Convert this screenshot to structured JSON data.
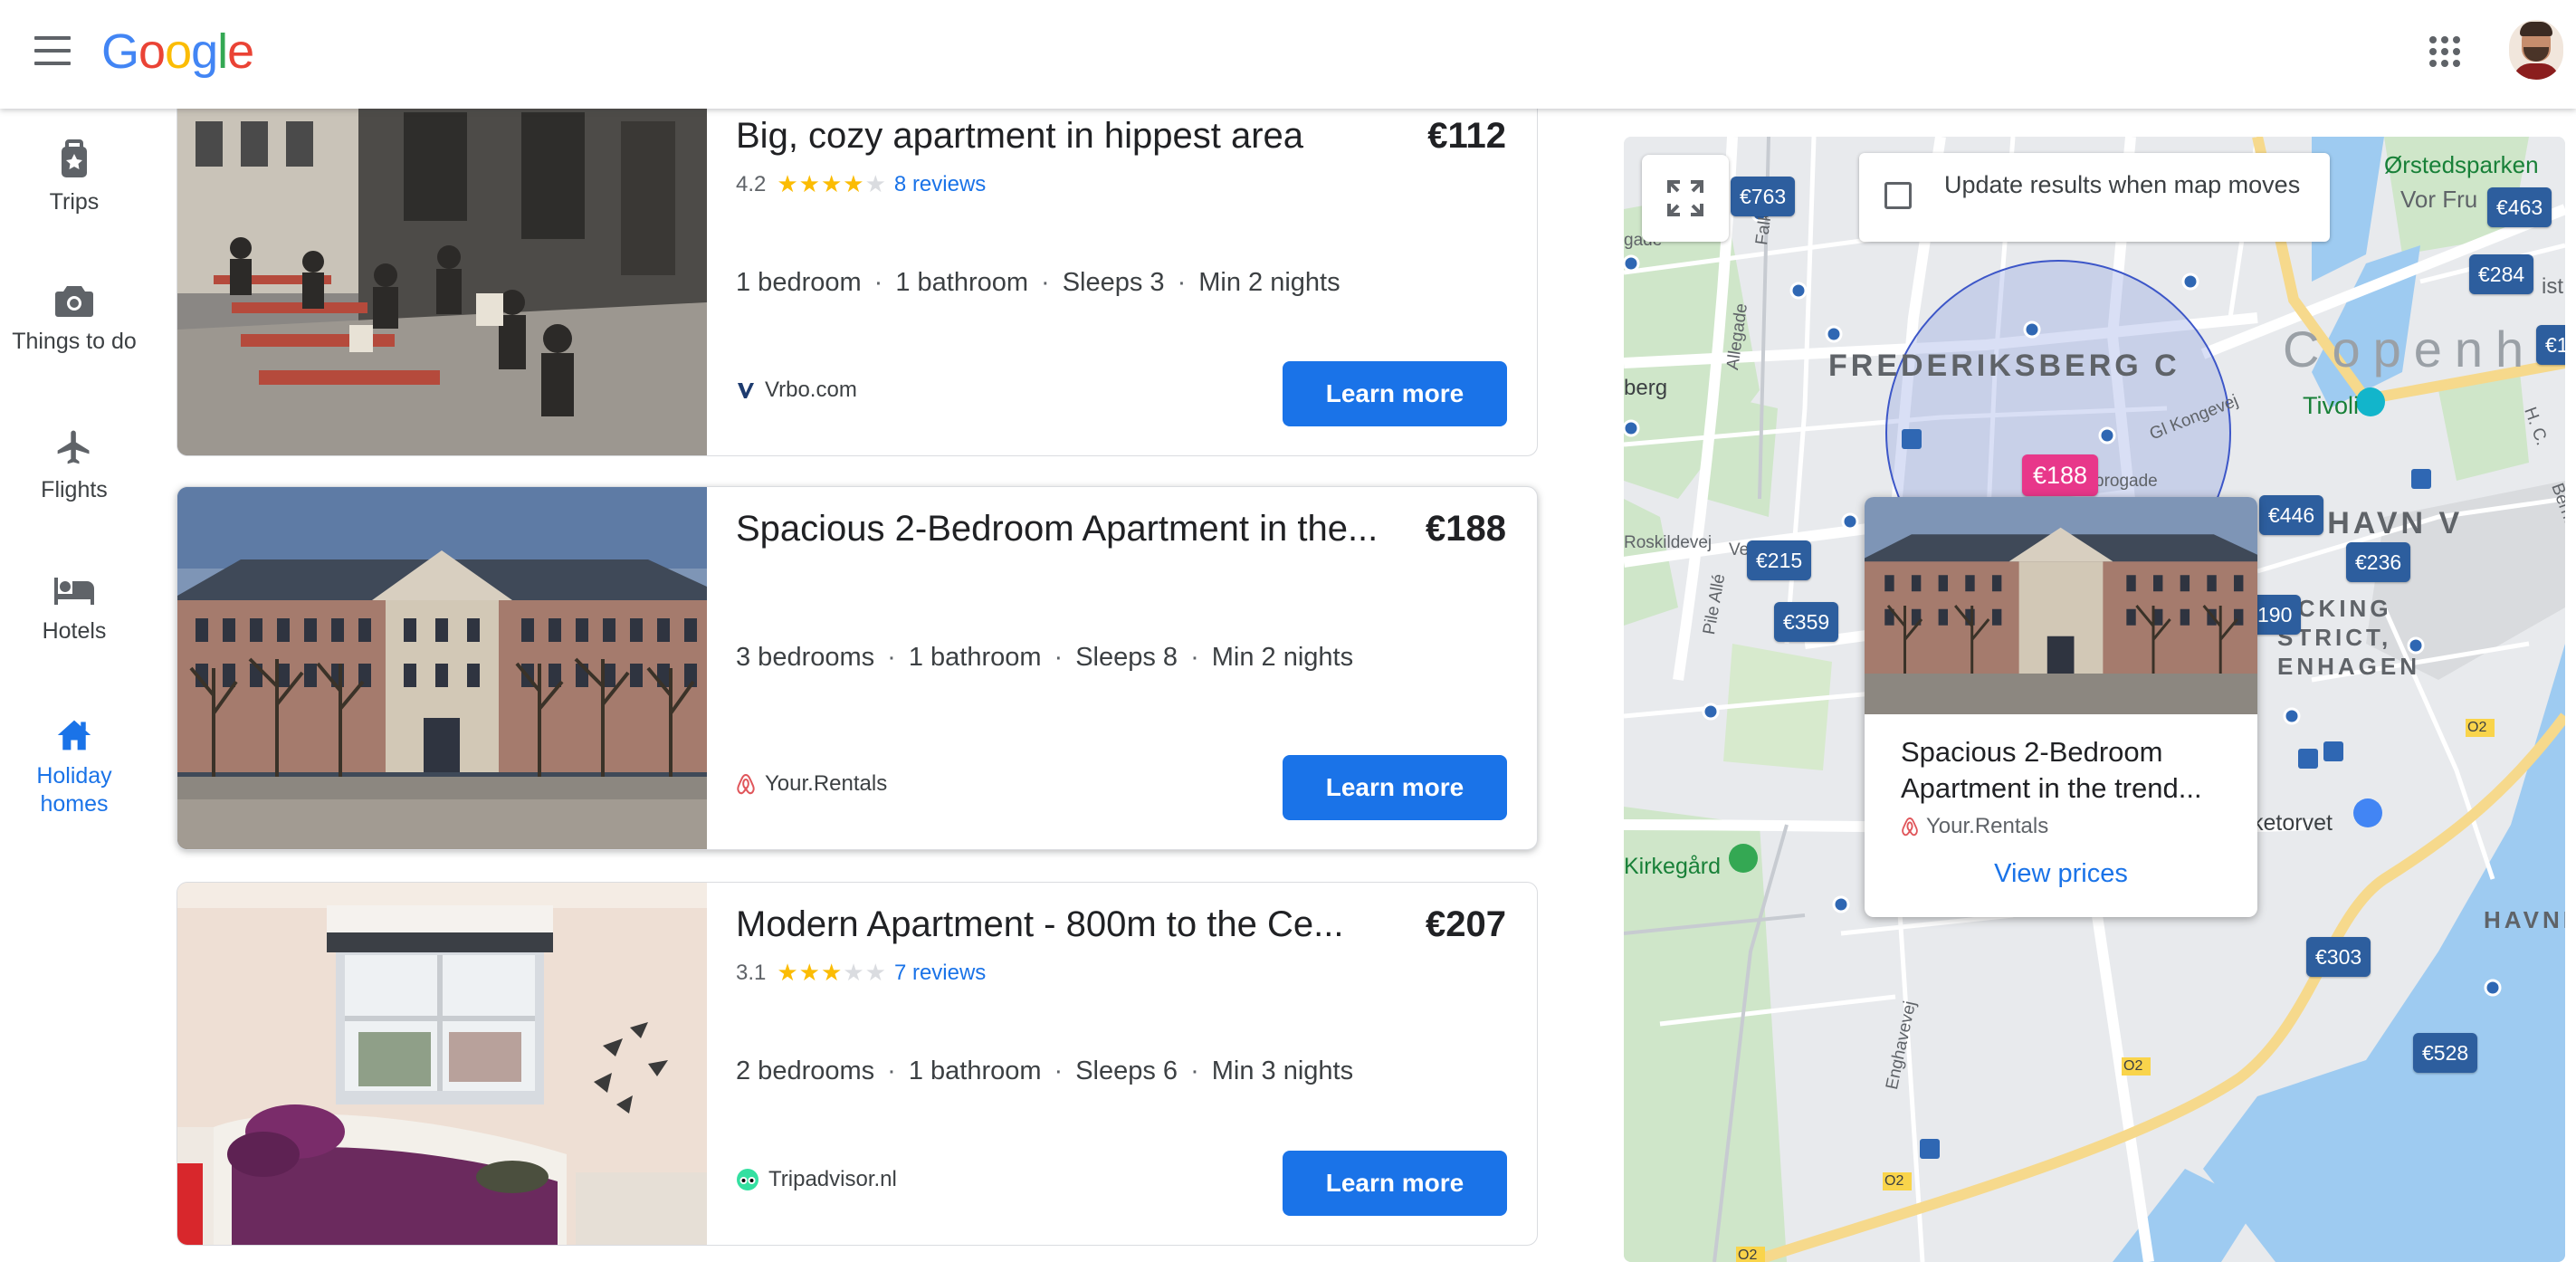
{
  "header": {
    "logo": [
      "G",
      "o",
      "o",
      "g",
      "l",
      "e"
    ],
    "menu_icon": "menu-icon",
    "apps_icon": "apps-grid-icon"
  },
  "nav": [
    {
      "label": "Trips",
      "icon": "trips-icon"
    },
    {
      "label": "Things to do",
      "icon": "camera-icon"
    },
    {
      "label": "Flights",
      "icon": "airplane-icon"
    },
    {
      "label": "Hotels",
      "icon": "bed-icon"
    },
    {
      "label": "Holiday homes",
      "icon": "home-icon",
      "active": true
    }
  ],
  "listings": [
    {
      "title": "Big, cozy apartment in hippest area",
      "price": "€112",
      "rating": "4.2",
      "stars": 4,
      "reviews": "8 reviews",
      "bedrooms": "1 bedroom",
      "bathrooms": "1 bathroom",
      "sleeps": "Sleeps 3",
      "min_nights": "Min 2 nights",
      "provider": "Vrbo.com",
      "cta": "Learn more"
    },
    {
      "title": "Spacious 2-Bedroom Apartment in the...",
      "price": "€188",
      "bedrooms": "3 bedrooms",
      "bathrooms": "1 bathroom",
      "sleeps": "Sleeps 8",
      "min_nights": "Min 2 nights",
      "provider": "Your.Rentals",
      "cta": "Learn more"
    },
    {
      "title": "Modern Apartment - 800m to the Ce...",
      "price": "€207",
      "rating": "3.1",
      "stars": 3,
      "reviews": "7 reviews",
      "bedrooms": "2 bedrooms",
      "bathrooms": "1 bathroom",
      "sleeps": "Sleeps 6",
      "min_nights": "Min 3 nights",
      "provider": "Tripadvisor.nl",
      "cta": "Learn more"
    }
  ],
  "map": {
    "update_label": "Update results when map moves",
    "areas": {
      "frederiksberg": "FREDERIKSBERG C",
      "copenhagen": "Copenh",
      "kobenhavn_v": "ENHAVN V",
      "packing": "ACKING",
      "district": "STRICT,",
      "enhagen": "ENHAGEN",
      "havnes": "HAVNES"
    },
    "places": {
      "orsted": "Ørstedsparken",
      "vorfru": "Vor Fru",
      "tivoli": "Tivoli",
      "kirkegard": "Kirkegård",
      "torvet": "ketorvet",
      "berg": "berg",
      "gade": "gade"
    },
    "streets": {
      "gl_kongevej": "Gl Kongevej",
      "vesterbrogade": "brogade",
      "allegade": "Allegade",
      "falkoner": "Falkon",
      "roskildevej": "Roskildevej",
      "pile_alle": "Pile Allé",
      "enghavevej": "Enghavevej",
      "bernstorffsgade": "Bernstorffsgade",
      "hc": "H. C.",
      "ist": "ist",
      "ve": "Ve",
      "o2": "O2"
    },
    "prices": [
      "€763",
      "€463",
      "€284",
      "€1",
      "€188",
      "€446",
      "€236",
      "€215",
      "€359",
      "190",
      "€303",
      "€528"
    ],
    "popup": {
      "title": "Spacious 2-Bedroom Apartment in the trend...",
      "provider": "Your.Rentals",
      "cta": "View prices"
    }
  }
}
